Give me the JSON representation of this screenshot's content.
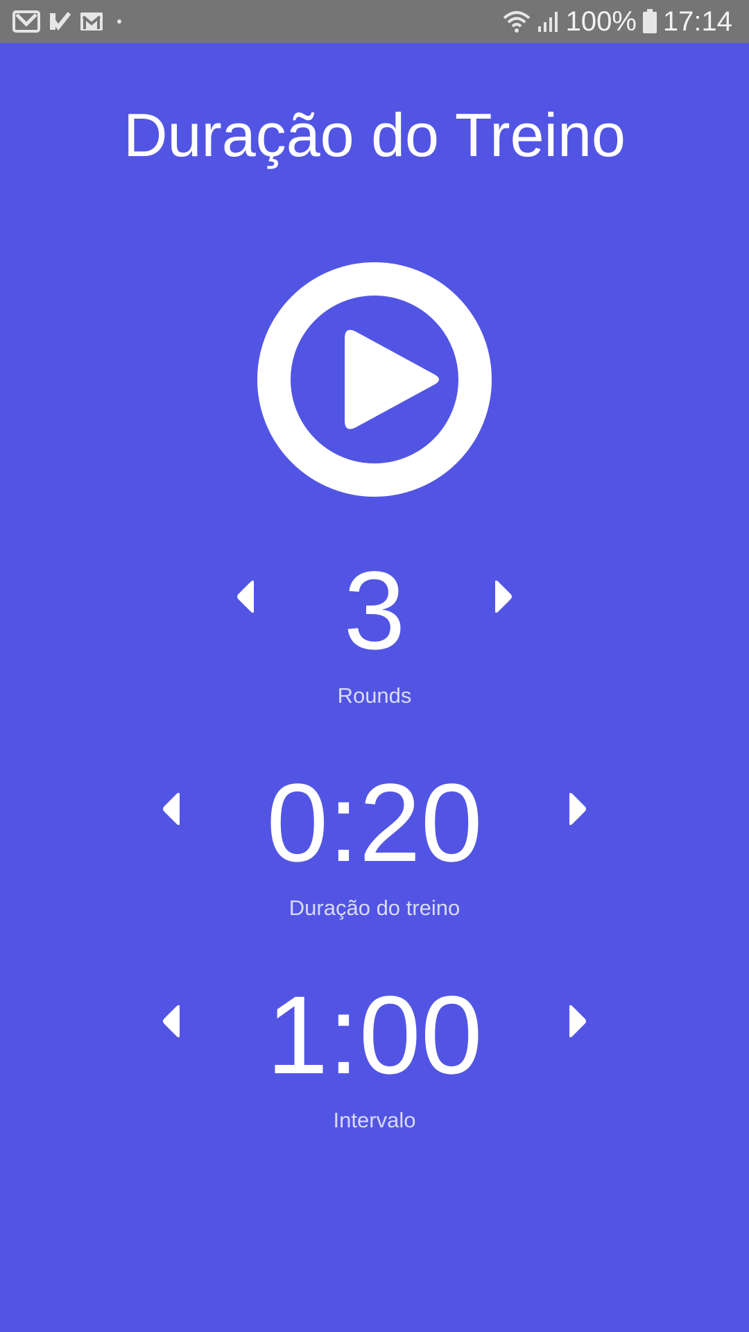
{
  "status_bar": {
    "left_icons": [
      "gmail-icon",
      "tasks-check-icon",
      "mail-icon",
      "dot-icon"
    ],
    "right_icons": [
      "wifi-icon",
      "signal-icon",
      "battery-icon"
    ],
    "battery": "100%",
    "time": "17:14"
  },
  "title": "Duração do Treino",
  "play": {
    "icon": "play-icon"
  },
  "steppers": [
    {
      "value": "3",
      "label": "Rounds"
    },
    {
      "value": "0:20",
      "label": "Duração do treino"
    },
    {
      "value": "1:00",
      "label": "Intervalo"
    }
  ],
  "colors": {
    "background": "#5255e3",
    "status_bar": "#757575",
    "foreground": "#ffffff",
    "caption": "#d9dbf7"
  }
}
